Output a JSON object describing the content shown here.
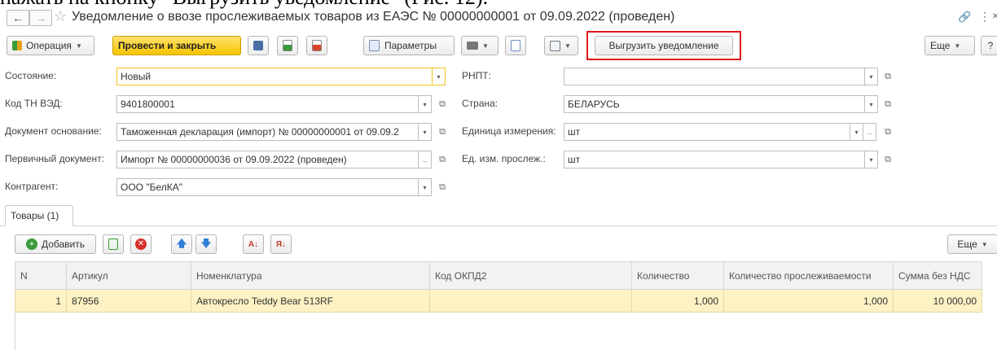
{
  "cropped_heading": "нажать на кнопку \"Выгрузить уведомление\" (Рис. 12).",
  "window": {
    "title": "Уведомление о ввозе прослеживаемых товаров из ЕАЭС № 00000000001 от 09.09.2022 (проведен)",
    "back_glyph": "←",
    "forward_glyph": "→",
    "star_glyph": "☆",
    "link_glyph": "🔗",
    "menu_glyph": "⋮",
    "close_glyph": "×"
  },
  "toolbar": {
    "operation": "Операция",
    "post_close": "Провести и закрыть",
    "params": "Параметры",
    "export_notice": "Выгрузить уведомление",
    "more": "Еще",
    "help": "?"
  },
  "form": {
    "state_label": "Состояние:",
    "state_value": "Новый",
    "tnved_label": "Код ТН ВЭД:",
    "tnved_value": "9401800001",
    "basis_label": "Документ основание:",
    "basis_value": "Таможенная декларация (импорт) № 00000000001 от 09.09.2",
    "primary_label": "Первичный документ:",
    "primary_value": "Импорт № 00000000036 от 09.09.2022 (проведен)",
    "counterparty_label": "Контрагент:",
    "counterparty_value": "ООО \"БелКА\"",
    "rnpt_label": "РНПТ:",
    "rnpt_value": "",
    "country_label": "Страна:",
    "country_value": "БЕЛАРУСЬ",
    "unit_label": "Единица измерения:",
    "unit_value": "шт",
    "track_unit_label": "Ед. изм. прослеж.:",
    "track_unit_value": "шт",
    "select_glyph": "▾",
    "open_glyph": "⧉",
    "dots_glyph": "..."
  },
  "tabs": {
    "goods": "Товары (1)"
  },
  "table_toolbar": {
    "add": "Добавить",
    "more": "Еще"
  },
  "table": {
    "headers": [
      "N",
      "Артикул",
      "Номенклатура",
      "Код ОКПД2",
      "Количество",
      "Количество прослеживаемости",
      "Сумма без НДС"
    ],
    "rows": [
      [
        "1",
        "87956",
        "Автокресло Teddy Bear 513RF",
        "",
        "1,000",
        "1,000",
        "10 000,00"
      ]
    ]
  },
  "colors": {
    "accent_yellow": "#f6c500",
    "highlight_red": "#e0151b",
    "row_selected": "#fcf2c4"
  }
}
